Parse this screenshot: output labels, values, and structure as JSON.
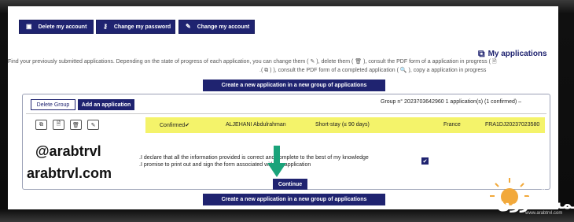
{
  "top_buttons": {
    "delete_account": "Delete my account",
    "change_password": "Change my password",
    "change_account": "Change my account"
  },
  "applications": {
    "title": "My applications",
    "info_line1": "Find your previously submitted applications. Depending on the state of progress of each application, you can change them ( ✎ ), delete them ( 🗑 ), consult the PDF form of a application in progress ( 🗎",
    "info_line2": ".( ⧉ ) ), consult the PDF form of a completed application ( 🔍 ), copy a application in progress",
    "create_new_top": "Create a new application in a new group of applications",
    "create_new_bottom": "Create a new application in a new group of applications"
  },
  "group": {
    "delete_group": "Delete Group",
    "add_application": "Add an application",
    "info": "Group n° 2023703642960 1 application(s) (1 confirmed) –",
    "row": {
      "status": "Confirmed✔",
      "name": "ALJEHANI Abdulrahman",
      "type": "Short-stay (≤ 90 days)",
      "country": "France",
      "reference": "FRA1DJ20237023580"
    },
    "declaration_line1": ".I declare that all the information provided is correct and complete to the best of my knowledge",
    "declaration_line2": ".I promise to print out and sign the form associated with my application",
    "continue": "Continue"
  },
  "watermark": {
    "handle": "@arabtrvl",
    "site": "arabtrvl.com",
    "logo_arabic": "المسافرون",
    "logo_arabic_small": "العرب",
    "logo_url": "www.arabtrvl.com"
  },
  "colors": {
    "accent": "#1f2370",
    "highlight": "#f4f36a",
    "arrow": "#1aa37a"
  }
}
